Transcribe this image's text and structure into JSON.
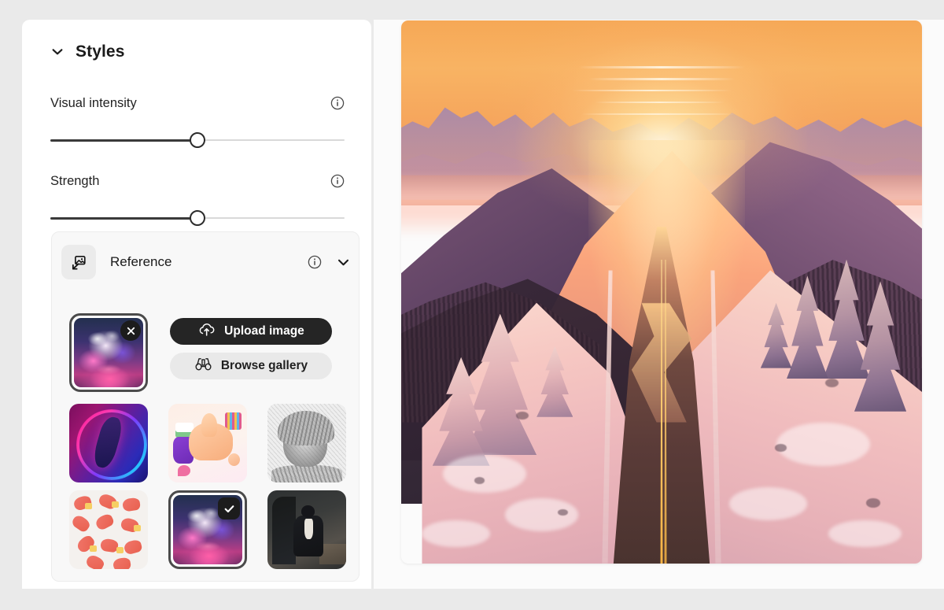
{
  "panel": {
    "section_title": "Styles",
    "collapse_icon": "chevron-down-icon"
  },
  "controls": [
    {
      "label": "Visual intensity",
      "info_icon": "info-icon",
      "slider": {
        "value_percent": 50,
        "name": "visual-intensity-slider"
      }
    },
    {
      "label": "Strength",
      "info_icon": "info-icon",
      "slider": {
        "value_percent": 50,
        "name": "strength-slider"
      }
    }
  ],
  "reference": {
    "title": "Reference",
    "badge_icon": "image-reference-icon",
    "info_icon": "info-icon",
    "collapse_icon": "chevron-down-icon",
    "selected_thumb": {
      "name": "reference-thumbnail",
      "art": "art-cloud",
      "remove_icon": "close-icon"
    },
    "buttons": [
      {
        "label": "Upload image",
        "icon": "cloud-upload-icon",
        "style": "primary",
        "name": "upload-image-button"
      },
      {
        "label": "Browse gallery",
        "icon": "binoculars-icon",
        "style": "secondary",
        "name": "browse-gallery-button"
      }
    ],
    "style_tiles": [
      {
        "name": "style-tile-neon-dancer",
        "art": "art-neon",
        "selected": false
      },
      {
        "name": "style-tile-thumbs-up",
        "art": "art-thumbsup",
        "selected": false
      },
      {
        "name": "style-tile-pencil-portrait",
        "art": "art-sketch",
        "selected": false
      },
      {
        "name": "style-tile-hand-pattern",
        "art": "art-hands",
        "selected": false
      },
      {
        "name": "style-tile-cloud",
        "art": "art-cloud",
        "selected": true
      },
      {
        "name": "style-tile-portrait-photo",
        "art": "art-portrait",
        "selected": false
      }
    ],
    "selected_check_icon": "check-icon"
  },
  "canvas": {
    "name": "generated-image",
    "description": "Aerial view of a winding mountain road on a snowy ridge at sunrise"
  },
  "colors": {
    "page_background": "#eaeaea",
    "panel_background": "#ffffff",
    "card_background": "#f8f8f8",
    "primary_button": "#252525",
    "secondary_button": "#e9e9e9",
    "slider_fill": "#3a3a3a",
    "slider_track": "#d9d9d9",
    "text_primary": "#1a1a1a"
  }
}
